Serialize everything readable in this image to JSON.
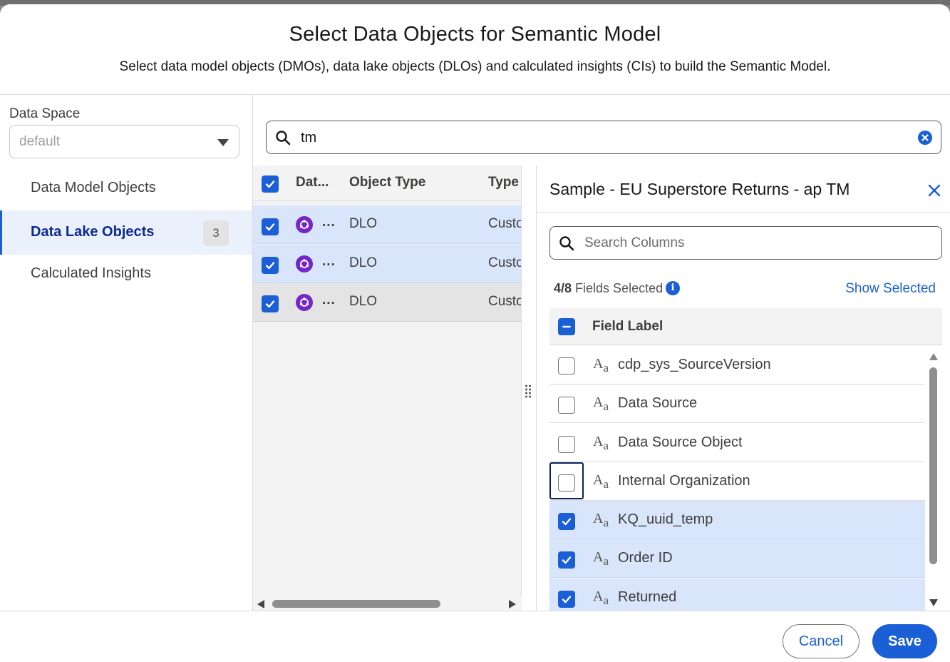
{
  "modal": {
    "title": "Select Data Objects for Semantic Model",
    "subtitle": "Select data model objects (DMOs), data lake objects (DLOs) and calculated insights (CIs) to build the Semantic Model."
  },
  "sidebar": {
    "data_space_label": "Data Space",
    "data_space_value": "default",
    "items": [
      {
        "label": "Data Model Objects"
      },
      {
        "label": "Data Lake Objects",
        "count": "3",
        "active": true
      },
      {
        "label": "Calculated Insights"
      }
    ]
  },
  "search": {
    "value": "tm"
  },
  "table": {
    "headers": [
      "Dat...",
      "Object Type",
      "Type"
    ],
    "rows": [
      {
        "name": "...",
        "object_type": "DLO",
        "type": "Custo",
        "checked": true
      },
      {
        "name": "...",
        "object_type": "DLO",
        "type": "Custo",
        "checked": true
      },
      {
        "name": "...",
        "object_type": "DLO",
        "type": "Custo",
        "checked": true
      }
    ]
  },
  "panel": {
    "title": "Sample - EU Superstore Returns - ap TM",
    "search_placeholder": "Search Columns",
    "fields_selected_count": "4/8",
    "fields_selected_text": " Fields Selected",
    "show_selected": "Show Selected",
    "field_header": "Field Label",
    "field_type_icon": "text-type-icon",
    "fields": [
      {
        "label": "cdp_sys_SourceVersion",
        "checked": false
      },
      {
        "label": "Data Source",
        "checked": false
      },
      {
        "label": "Data Source Object",
        "checked": false
      },
      {
        "label": "Internal Organization",
        "checked": false,
        "focused": true
      },
      {
        "label": "KQ_uuid_temp",
        "checked": true
      },
      {
        "label": "Order ID",
        "checked": true
      },
      {
        "label": "Returned",
        "checked": true
      }
    ]
  },
  "footer": {
    "cancel": "Cancel",
    "save": "Save"
  },
  "colors": {
    "brand": "#1b5fd6",
    "selected_row": "#d9e5fb",
    "dlo_icon": "#7526c7"
  }
}
